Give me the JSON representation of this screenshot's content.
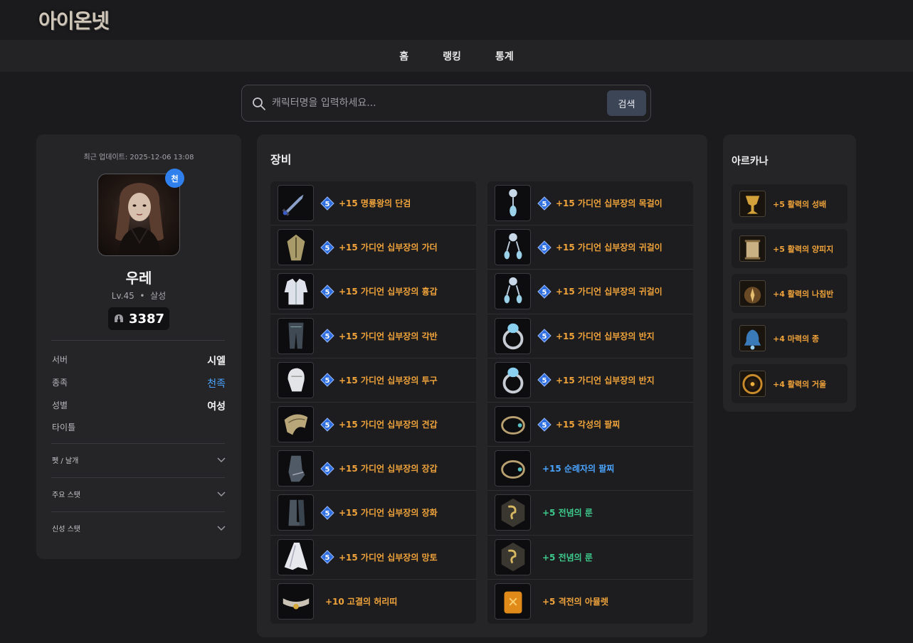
{
  "site": {
    "logo": "아이온넷"
  },
  "nav": {
    "items": [
      "홈",
      "랭킹",
      "통계"
    ]
  },
  "search": {
    "placeholder": "캐릭터명을 입력하세요...",
    "button_label": "검색"
  },
  "profile": {
    "updated": "최근 업데이트: 2025-12-06 13:08",
    "race_badge": "천",
    "name": "우레",
    "level": "Lv.45",
    "class": "살성",
    "combat_power": "3387",
    "info": [
      {
        "key": "서버",
        "value": "시엘"
      },
      {
        "key": "종족",
        "value": "천족"
      },
      {
        "key": "성별",
        "value": "여성"
      },
      {
        "key": "타이틀",
        "value": ""
      }
    ],
    "accordions": [
      "펫 / 날개",
      "주요 스탯",
      "신성 스탯"
    ]
  },
  "colors": {
    "orange": "#f0a33a",
    "blue": "#4aa3ff",
    "green": "#3dc98b",
    "enchant_badge": "#2f6fe0",
    "race_badge": "#2f80ed"
  },
  "equipment": {
    "title": "장비",
    "left": [
      {
        "icon": "dagger-icon",
        "enchant": "5",
        "name": "+15  명룡왕의 단검",
        "color": "orange"
      },
      {
        "icon": "guarder-icon",
        "enchant": "5",
        "name": "+15  가디언 십부장의 가더",
        "color": "orange"
      },
      {
        "icon": "chest-armor-icon",
        "enchant": "5",
        "name": "+15  가디언 십부장의 흉갑",
        "color": "orange"
      },
      {
        "icon": "leg-armor-icon",
        "enchant": "5",
        "name": "+15  가디언 십부장의 각반",
        "color": "orange"
      },
      {
        "icon": "helmet-icon",
        "enchant": "5",
        "name": "+15  가디언 십부장의 투구",
        "color": "orange"
      },
      {
        "icon": "shoulder-armor-icon",
        "enchant": "5",
        "name": "+15  가디언 십부장의 견갑",
        "color": "orange"
      },
      {
        "icon": "gloves-icon",
        "enchant": "5",
        "name": "+15  가디언 십부장의 장갑",
        "color": "orange"
      },
      {
        "icon": "boots-icon",
        "enchant": "5",
        "name": "+15  가디언 십부장의 장화",
        "color": "orange"
      },
      {
        "icon": "cape-icon",
        "enchant": "5",
        "name": "+15  가디언 십부장의 망토",
        "color": "orange"
      },
      {
        "icon": "belt-icon",
        "enchant": "",
        "name": "+10  고결의 허리띠",
        "color": "orange"
      }
    ],
    "right": [
      {
        "icon": "necklace-icon",
        "enchant": "5",
        "name": "+15  가디언 십부장의 목걸이",
        "color": "orange"
      },
      {
        "icon": "earring-icon",
        "enchant": "5",
        "name": "+15  가디언 십부장의 귀걸이",
        "color": "orange"
      },
      {
        "icon": "earring-icon",
        "enchant": "5",
        "name": "+15  가디언 십부장의 귀걸이",
        "color": "orange"
      },
      {
        "icon": "ring-icon",
        "enchant": "5",
        "name": "+15  가디언 십부장의 반지",
        "color": "orange"
      },
      {
        "icon": "ring-icon",
        "enchant": "5",
        "name": "+15  가디언 십부장의 반지",
        "color": "orange"
      },
      {
        "icon": "bracelet-icon",
        "enchant": "5",
        "name": "+15  각성의 팔찌",
        "color": "orange"
      },
      {
        "icon": "bracelet-icon",
        "enchant": "",
        "name": "+15  순례자의 팔찌",
        "color": "blue"
      },
      {
        "icon": "rune-icon",
        "enchant": "",
        "name": "+5  전념의 룬",
        "color": "green"
      },
      {
        "icon": "rune-icon",
        "enchant": "",
        "name": "+5  전념의 룬",
        "color": "green"
      },
      {
        "icon": "amulet-icon",
        "enchant": "",
        "name": "+5  격전의 아뮬렛",
        "color": "orange"
      }
    ]
  },
  "arcana": {
    "title": "아르카나",
    "items": [
      {
        "icon": "chalice-icon",
        "name": "+5  활력의 성배"
      },
      {
        "icon": "scroll-icon",
        "name": "+5  활력의 양피지"
      },
      {
        "icon": "compass-icon",
        "name": "+4  활력의 나침반"
      },
      {
        "icon": "bell-icon",
        "name": "+4  마력의 종"
      },
      {
        "icon": "mirror-icon",
        "name": "+4  활력의 거울"
      }
    ]
  }
}
